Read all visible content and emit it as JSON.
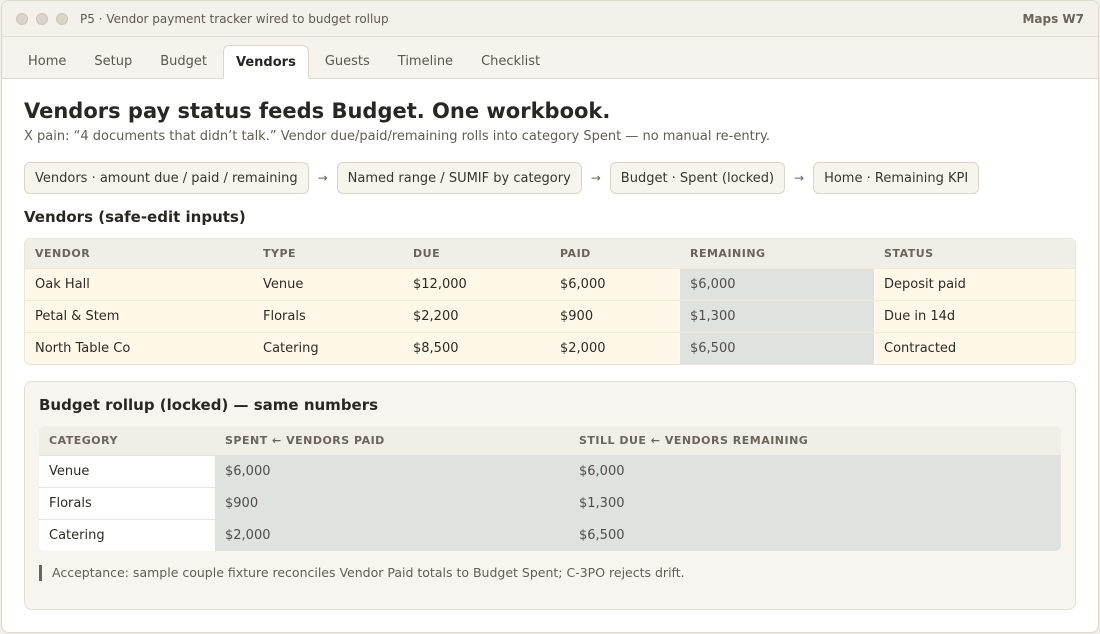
{
  "window": {
    "title": "P5 · Vendor payment tracker wired to budget rollup",
    "brand": "Maps W7"
  },
  "tabs": [
    "Home",
    "Setup",
    "Budget",
    "Vendors",
    "Guests",
    "Timeline",
    "Checklist"
  ],
  "active_tab": "Vendors",
  "page": {
    "heading": "Vendors pay status feeds Budget. One workbook.",
    "subtitle": "X pain: “4 documents that didn’t talk.” Vendor due/paid/remaining rolls into category Spent — no manual re-entry."
  },
  "flow": {
    "steps": [
      "Vendors · amount due / paid / remaining",
      "Named range / SUMIF by category",
      "Budget · Spent (locked)",
      "Home · Remaining KPI"
    ],
    "arrow": "→"
  },
  "vendors": {
    "heading": "Vendors (safe-edit inputs)",
    "columns": [
      "VENDOR",
      "TYPE",
      "DUE",
      "PAID",
      "REMAINING",
      "STATUS"
    ],
    "rows": [
      [
        "Oak Hall",
        "Venue",
        "$12,000",
        "$6,000",
        "$6,000",
        "Deposit paid"
      ],
      [
        "Petal & Stem",
        "Florals",
        "$2,200",
        "$900",
        "$1,300",
        "Due in 14d"
      ],
      [
        "North Table Co",
        "Catering",
        "$8,500",
        "$2,000",
        "$6,500",
        "Contracted"
      ]
    ]
  },
  "rollup": {
    "heading": "Budget rollup (locked) — same numbers",
    "columns": [
      "CATEGORY",
      "SPENT ← VENDORS PAID",
      "STILL DUE ← VENDORS REMAINING"
    ],
    "rows": [
      [
        "Venue",
        "$6,000",
        "$6,000"
      ],
      [
        "Florals",
        "$900",
        "$1,300"
      ],
      [
        "Catering",
        "$2,000",
        "$6,500"
      ]
    ],
    "acceptance": "Acceptance: sample couple fixture reconciles Vendor Paid totals to Budget Spent; C-3PO rejects drift."
  },
  "colors": {
    "input_row": "#fff8e8",
    "locked_cell": "#dfe3df",
    "accent": "#2a2622"
  }
}
